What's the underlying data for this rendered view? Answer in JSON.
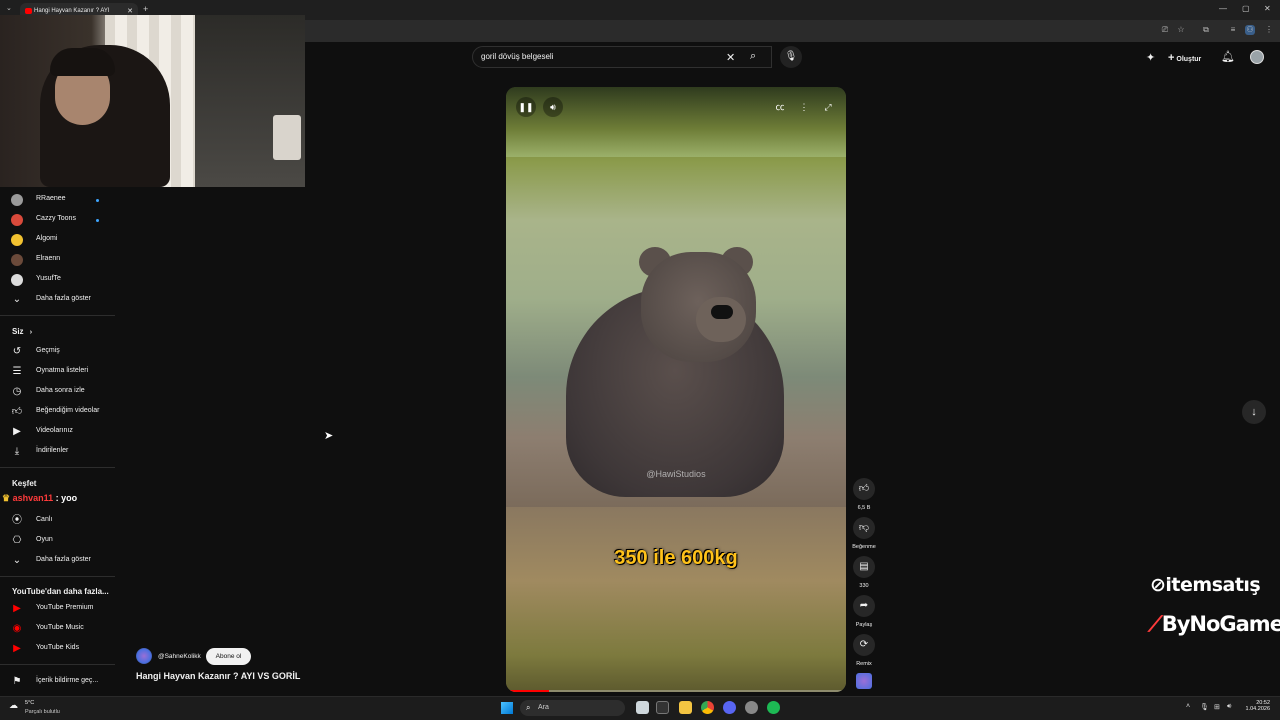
{
  "browser": {
    "tab_title": "Hangi Hayvan Kazanır ? AYI",
    "new_tab": "+"
  },
  "header": {
    "search_value": "goril dövüş belgeseli",
    "create_label": "Oluştur"
  },
  "sidebar": {
    "subscriptions": [
      {
        "label": "RRaenee",
        "color": "#9a9a9a",
        "dot": true
      },
      {
        "label": "Cazzy Toons",
        "color": "#d94a3b",
        "dot": true
      },
      {
        "label": "Algomi",
        "color": "#f2c230",
        "dot": false
      },
      {
        "label": "Elraenn",
        "color": "#6b4a3a",
        "dot": false
      },
      {
        "label": "YusufTe",
        "color": "#dcdcdc",
        "dot": false
      }
    ],
    "show_more": "Daha fazla göster",
    "you_section": {
      "title": "Siz",
      "items": [
        "Geçmiş",
        "Oynatma listeleri",
        "Daha sonra izle",
        "Beğendiğim videolar",
        "Videolarınız",
        "İndirilenler"
      ]
    },
    "explore_section": {
      "title": "Keşfet",
      "items": [
        "Canlı",
        "Oyun"
      ],
      "show_more": "Daha fazla göster"
    },
    "more_section": {
      "title": "YouTube'dan daha fazla...",
      "items": [
        "YouTube Premium",
        "YouTube Music",
        "YouTube Kids"
      ]
    },
    "report": "İçerik bildirme geç..."
  },
  "video": {
    "watermark": "@HawiStudios",
    "caption": "350 ile 600kg",
    "progress": 0.125
  },
  "actions": {
    "likes": "6,5 B",
    "dislike_label": "Beğenme",
    "comments": "330",
    "share_label": "Paylaş",
    "remix_label": "Remix"
  },
  "channel": {
    "name": "@SahneKolikk",
    "subscribe_label": "Abone ol",
    "video_title": "Hangi Hayvan Kazanır ? AYI VS GORİL"
  },
  "overlay": {
    "chat_user": "ashvan11",
    "chat_message": ": yoo",
    "sponsor1": "itemsatış",
    "sponsor2": "ByNoGame"
  },
  "taskbar": {
    "weather_temp": "5°C",
    "weather_desc": "Parçalı bulutlu",
    "search_placeholder": "Ara",
    "time": "20:52",
    "date": "1.04.2026"
  }
}
